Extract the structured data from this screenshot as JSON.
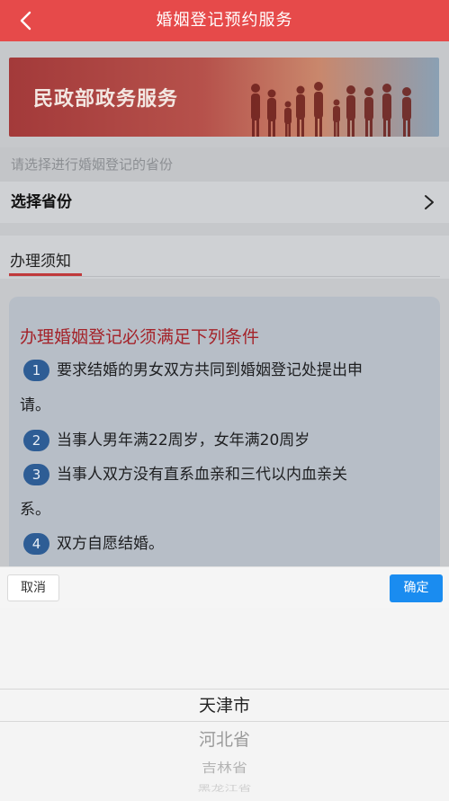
{
  "header": {
    "title": "婚姻登记预约服务",
    "back_icon": "chevron-left-icon"
  },
  "banner": {
    "title": "民政部政务服务"
  },
  "hint": "请选择进行婚姻登记的省份",
  "select_province": {
    "label": "选择省份",
    "icon": "chevron-right-icon"
  },
  "notice": {
    "tab": "办理须知",
    "card_title": "办理婚姻登记必须满足下列条件",
    "items": [
      {
        "num": "1",
        "line1": "要求结婚的男女双方共同到婚姻登记处提出申",
        "line2": "请。"
      },
      {
        "num": "2",
        "line1": "当事人男年满22周岁，女年满20周岁"
      },
      {
        "num": "3",
        "line1": "当事人双方没有直系血亲和三代以内血亲关",
        "line2": "系。"
      },
      {
        "num": "4",
        "line1": "双方自愿结婚。"
      }
    ]
  },
  "picker": {
    "cancel": "取消",
    "confirm": "确定",
    "options": [
      "天津市",
      "河北省",
      "吉林省",
      "黑龙江省"
    ],
    "selected": "天津市"
  },
  "colors": {
    "header": "#e64a4a",
    "accent_red": "#a4232a",
    "badge_blue": "#2e5d95",
    "confirm_blue": "#1a8cf0"
  }
}
